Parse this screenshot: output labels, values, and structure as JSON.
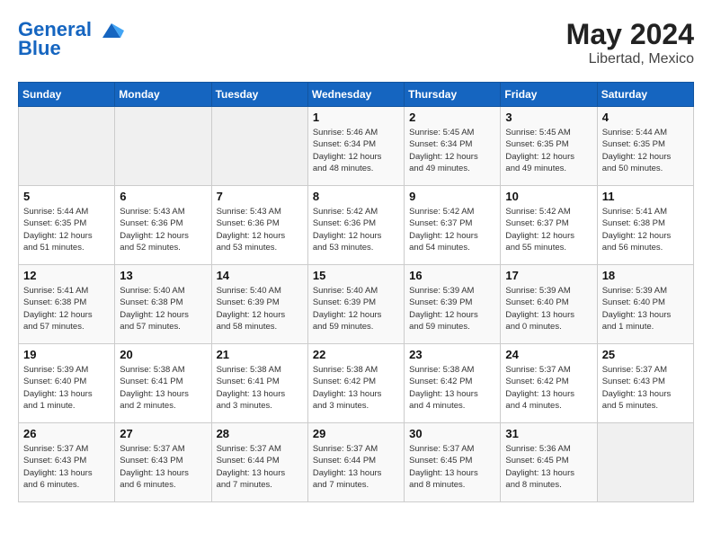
{
  "header": {
    "logo_line1": "General",
    "logo_line2": "Blue",
    "month_year": "May 2024",
    "location": "Libertad, Mexico"
  },
  "days_of_week": [
    "Sunday",
    "Monday",
    "Tuesday",
    "Wednesday",
    "Thursday",
    "Friday",
    "Saturday"
  ],
  "weeks": [
    [
      {
        "day": "",
        "info": ""
      },
      {
        "day": "",
        "info": ""
      },
      {
        "day": "",
        "info": ""
      },
      {
        "day": "1",
        "info": "Sunrise: 5:46 AM\nSunset: 6:34 PM\nDaylight: 12 hours\nand 48 minutes."
      },
      {
        "day": "2",
        "info": "Sunrise: 5:45 AM\nSunset: 6:34 PM\nDaylight: 12 hours\nand 49 minutes."
      },
      {
        "day": "3",
        "info": "Sunrise: 5:45 AM\nSunset: 6:35 PM\nDaylight: 12 hours\nand 49 minutes."
      },
      {
        "day": "4",
        "info": "Sunrise: 5:44 AM\nSunset: 6:35 PM\nDaylight: 12 hours\nand 50 minutes."
      }
    ],
    [
      {
        "day": "5",
        "info": "Sunrise: 5:44 AM\nSunset: 6:35 PM\nDaylight: 12 hours\nand 51 minutes."
      },
      {
        "day": "6",
        "info": "Sunrise: 5:43 AM\nSunset: 6:36 PM\nDaylight: 12 hours\nand 52 minutes."
      },
      {
        "day": "7",
        "info": "Sunrise: 5:43 AM\nSunset: 6:36 PM\nDaylight: 12 hours\nand 53 minutes."
      },
      {
        "day": "8",
        "info": "Sunrise: 5:42 AM\nSunset: 6:36 PM\nDaylight: 12 hours\nand 53 minutes."
      },
      {
        "day": "9",
        "info": "Sunrise: 5:42 AM\nSunset: 6:37 PM\nDaylight: 12 hours\nand 54 minutes."
      },
      {
        "day": "10",
        "info": "Sunrise: 5:42 AM\nSunset: 6:37 PM\nDaylight: 12 hours\nand 55 minutes."
      },
      {
        "day": "11",
        "info": "Sunrise: 5:41 AM\nSunset: 6:38 PM\nDaylight: 12 hours\nand 56 minutes."
      }
    ],
    [
      {
        "day": "12",
        "info": "Sunrise: 5:41 AM\nSunset: 6:38 PM\nDaylight: 12 hours\nand 57 minutes."
      },
      {
        "day": "13",
        "info": "Sunrise: 5:40 AM\nSunset: 6:38 PM\nDaylight: 12 hours\nand 57 minutes."
      },
      {
        "day": "14",
        "info": "Sunrise: 5:40 AM\nSunset: 6:39 PM\nDaylight: 12 hours\nand 58 minutes."
      },
      {
        "day": "15",
        "info": "Sunrise: 5:40 AM\nSunset: 6:39 PM\nDaylight: 12 hours\nand 59 minutes."
      },
      {
        "day": "16",
        "info": "Sunrise: 5:39 AM\nSunset: 6:39 PM\nDaylight: 12 hours\nand 59 minutes."
      },
      {
        "day": "17",
        "info": "Sunrise: 5:39 AM\nSunset: 6:40 PM\nDaylight: 13 hours\nand 0 minutes."
      },
      {
        "day": "18",
        "info": "Sunrise: 5:39 AM\nSunset: 6:40 PM\nDaylight: 13 hours\nand 1 minute."
      }
    ],
    [
      {
        "day": "19",
        "info": "Sunrise: 5:39 AM\nSunset: 6:40 PM\nDaylight: 13 hours\nand 1 minute."
      },
      {
        "day": "20",
        "info": "Sunrise: 5:38 AM\nSunset: 6:41 PM\nDaylight: 13 hours\nand 2 minutes."
      },
      {
        "day": "21",
        "info": "Sunrise: 5:38 AM\nSunset: 6:41 PM\nDaylight: 13 hours\nand 3 minutes."
      },
      {
        "day": "22",
        "info": "Sunrise: 5:38 AM\nSunset: 6:42 PM\nDaylight: 13 hours\nand 3 minutes."
      },
      {
        "day": "23",
        "info": "Sunrise: 5:38 AM\nSunset: 6:42 PM\nDaylight: 13 hours\nand 4 minutes."
      },
      {
        "day": "24",
        "info": "Sunrise: 5:37 AM\nSunset: 6:42 PM\nDaylight: 13 hours\nand 4 minutes."
      },
      {
        "day": "25",
        "info": "Sunrise: 5:37 AM\nSunset: 6:43 PM\nDaylight: 13 hours\nand 5 minutes."
      }
    ],
    [
      {
        "day": "26",
        "info": "Sunrise: 5:37 AM\nSunset: 6:43 PM\nDaylight: 13 hours\nand 6 minutes."
      },
      {
        "day": "27",
        "info": "Sunrise: 5:37 AM\nSunset: 6:43 PM\nDaylight: 13 hours\nand 6 minutes."
      },
      {
        "day": "28",
        "info": "Sunrise: 5:37 AM\nSunset: 6:44 PM\nDaylight: 13 hours\nand 7 minutes."
      },
      {
        "day": "29",
        "info": "Sunrise: 5:37 AM\nSunset: 6:44 PM\nDaylight: 13 hours\nand 7 minutes."
      },
      {
        "day": "30",
        "info": "Sunrise: 5:37 AM\nSunset: 6:45 PM\nDaylight: 13 hours\nand 8 minutes."
      },
      {
        "day": "31",
        "info": "Sunrise: 5:36 AM\nSunset: 6:45 PM\nDaylight: 13 hours\nand 8 minutes."
      },
      {
        "day": "",
        "info": ""
      }
    ]
  ]
}
